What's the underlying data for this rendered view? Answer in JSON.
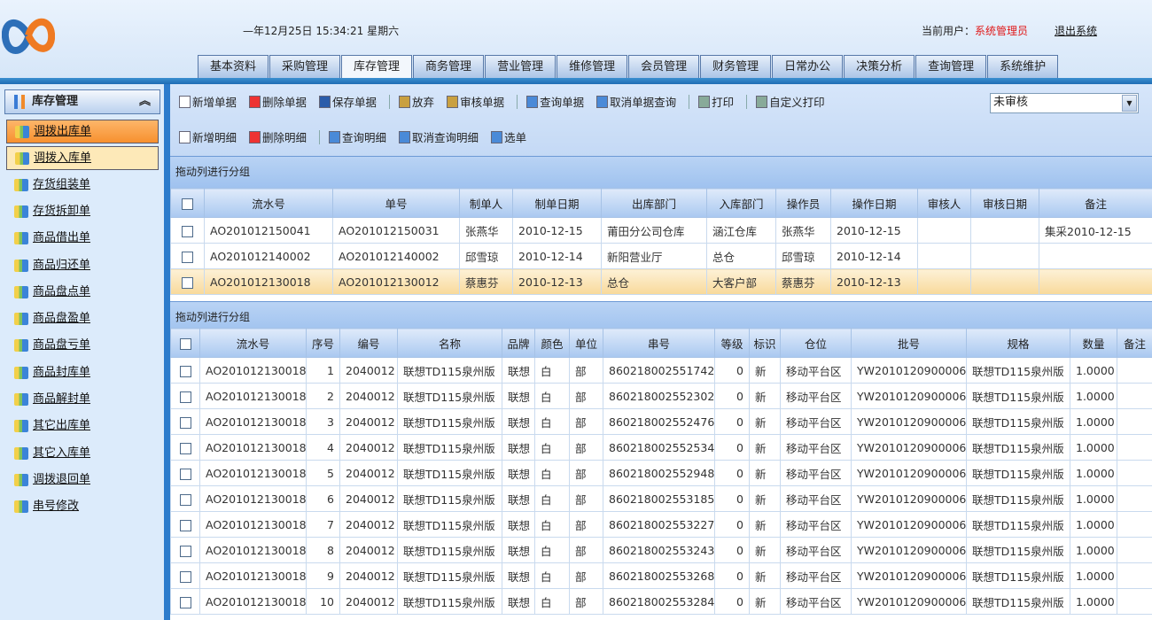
{
  "header": {
    "clock": "—年12月25日 15:34:21 星期六",
    "user_label": "当前用户：",
    "user_name": "系统管理员",
    "logout": "退出系统",
    "accent": "#e01818"
  },
  "tabs": [
    "基本资料",
    "采购管理",
    "库存管理",
    "商务管理",
    "营业管理",
    "维修管理",
    "会员管理",
    "财务管理",
    "日常办公",
    "决策分析",
    "查询管理",
    "系统维护"
  ],
  "active_tab": "库存管理",
  "sidebar": {
    "title": "库存管理",
    "items": [
      "调拨出库单",
      "调拨入库单",
      "存货组装单",
      "存货拆卸单",
      "商品借出单",
      "商品归还单",
      "商品盘点单",
      "商品盘盈单",
      "商品盘亏单",
      "商品封库单",
      "商品解封单",
      "其它出库单",
      "其它入库单",
      "调拨退回单",
      "串号修改"
    ]
  },
  "toolbar": {
    "row1": [
      "新增单据",
      "删除单据",
      "保存单据",
      "放弃",
      "审核单据",
      "查询单据",
      "取消单据查询",
      "打印",
      "自定义打印"
    ],
    "row2": [
      "新增明细",
      "删除明细",
      "查询明细",
      "取消查询明细",
      "选单"
    ],
    "status_filter": "未审核"
  },
  "group_hint": "拖动列进行分组",
  "master": {
    "columns": [
      "流水号",
      "单号",
      "制单人",
      "制单日期",
      "出库部门",
      "入库部门",
      "操作员",
      "操作日期",
      "审核人",
      "审核日期",
      "备注"
    ],
    "rows": [
      [
        "AO201012150041",
        "AO201012150031",
        "张燕华",
        "2010-12-15",
        "莆田分公司仓库",
        "涵江仓库",
        "张燕华",
        "2010-12-15",
        "",
        "",
        "集采2010-12-15"
      ],
      [
        "AO201012140002",
        "AO201012140002",
        "邱雪琼",
        "2010-12-14",
        "新阳营业厅",
        "总仓",
        "邱雪琼",
        "2010-12-14",
        "",
        "",
        ""
      ],
      [
        "AO201012130018",
        "AO201012130012",
        "蔡惠芬",
        "2010-12-13",
        "总仓",
        "大客户部",
        "蔡惠芬",
        "2010-12-13",
        "",
        "",
        ""
      ]
    ]
  },
  "detail": {
    "columns": [
      "流水号",
      "序号",
      "编号",
      "名称",
      "品牌",
      "颜色",
      "单位",
      "串号",
      "等级",
      "标识",
      "仓位",
      "批号",
      "规格",
      "数量",
      "备注"
    ],
    "rows": [
      [
        "AO201012130018",
        "1",
        "2040012",
        "联想TD115泉州版",
        "联想",
        "白",
        "部",
        "860218002551742",
        "0",
        "新",
        "移动平台区",
        "YW2010120900006",
        "联想TD115泉州版",
        "1.0000",
        ""
      ],
      [
        "AO201012130018",
        "2",
        "2040012",
        "联想TD115泉州版",
        "联想",
        "白",
        "部",
        "860218002552302",
        "0",
        "新",
        "移动平台区",
        "YW2010120900006",
        "联想TD115泉州版",
        "1.0000",
        ""
      ],
      [
        "AO201012130018",
        "3",
        "2040012",
        "联想TD115泉州版",
        "联想",
        "白",
        "部",
        "860218002552476",
        "0",
        "新",
        "移动平台区",
        "YW2010120900006",
        "联想TD115泉州版",
        "1.0000",
        ""
      ],
      [
        "AO201012130018",
        "4",
        "2040012",
        "联想TD115泉州版",
        "联想",
        "白",
        "部",
        "860218002552534",
        "0",
        "新",
        "移动平台区",
        "YW2010120900006",
        "联想TD115泉州版",
        "1.0000",
        ""
      ],
      [
        "AO201012130018",
        "5",
        "2040012",
        "联想TD115泉州版",
        "联想",
        "白",
        "部",
        "860218002552948",
        "0",
        "新",
        "移动平台区",
        "YW2010120900006",
        "联想TD115泉州版",
        "1.0000",
        ""
      ],
      [
        "AO201012130018",
        "6",
        "2040012",
        "联想TD115泉州版",
        "联想",
        "白",
        "部",
        "860218002553185",
        "0",
        "新",
        "移动平台区",
        "YW2010120900006",
        "联想TD115泉州版",
        "1.0000",
        ""
      ],
      [
        "AO201012130018",
        "7",
        "2040012",
        "联想TD115泉州版",
        "联想",
        "白",
        "部",
        "860218002553227",
        "0",
        "新",
        "移动平台区",
        "YW2010120900006",
        "联想TD115泉州版",
        "1.0000",
        ""
      ],
      [
        "AO201012130018",
        "8",
        "2040012",
        "联想TD115泉州版",
        "联想",
        "白",
        "部",
        "860218002553243",
        "0",
        "新",
        "移动平台区",
        "YW2010120900006",
        "联想TD115泉州版",
        "1.0000",
        ""
      ],
      [
        "AO201012130018",
        "9",
        "2040012",
        "联想TD115泉州版",
        "联想",
        "白",
        "部",
        "860218002553268",
        "0",
        "新",
        "移动平台区",
        "YW2010120900006",
        "联想TD115泉州版",
        "1.0000",
        ""
      ],
      [
        "AO201012130018",
        "10",
        "2040012",
        "联想TD115泉州版",
        "联想",
        "白",
        "部",
        "860218002553284",
        "0",
        "新",
        "移动平台区",
        "YW2010120900006",
        "联想TD115泉州版",
        "1.0000",
        ""
      ]
    ]
  }
}
